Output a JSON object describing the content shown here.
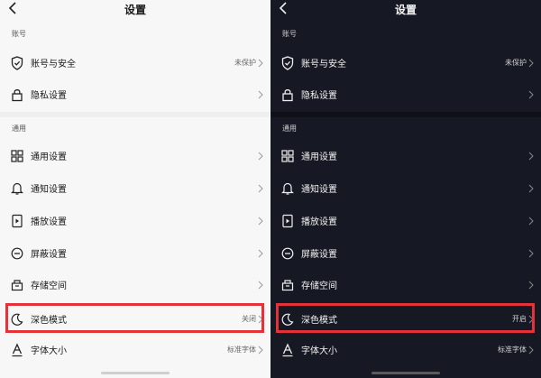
{
  "light": {
    "title": "设置",
    "sections": [
      {
        "label": "账号",
        "items": [
          {
            "icon": "shield-icon",
            "label": "账号与安全",
            "value": "未保护"
          },
          {
            "icon": "lock-icon",
            "label": "隐私设置",
            "value": ""
          }
        ]
      },
      {
        "label": "通用",
        "items": [
          {
            "icon": "grid-icon",
            "label": "通用设置",
            "value": ""
          },
          {
            "icon": "bell-icon",
            "label": "通知设置",
            "value": ""
          },
          {
            "icon": "play-icon",
            "label": "播放设置",
            "value": ""
          },
          {
            "icon": "block-icon",
            "label": "屏蔽设置",
            "value": ""
          },
          {
            "icon": "storage-icon",
            "label": "存储空间",
            "value": ""
          },
          {
            "icon": "moon-icon",
            "label": "深色模式",
            "value": "关闭"
          },
          {
            "icon": "font-icon",
            "label": "字体大小",
            "value": "标准字体"
          }
        ]
      }
    ]
  },
  "dark": {
    "title": "设置",
    "sections": [
      {
        "label": "账号",
        "items": [
          {
            "icon": "shield-icon",
            "label": "账号与安全",
            "value": "未保护"
          },
          {
            "icon": "lock-icon",
            "label": "隐私设置",
            "value": ""
          }
        ]
      },
      {
        "label": "通用",
        "items": [
          {
            "icon": "grid-icon",
            "label": "通用设置",
            "value": ""
          },
          {
            "icon": "bell-icon",
            "label": "通知设置",
            "value": ""
          },
          {
            "icon": "play-icon",
            "label": "播放设置",
            "value": ""
          },
          {
            "icon": "block-icon",
            "label": "屏蔽设置",
            "value": ""
          },
          {
            "icon": "storage-icon",
            "label": "存储空间",
            "value": ""
          },
          {
            "icon": "moon-icon",
            "label": "深色模式",
            "value": "开启"
          },
          {
            "icon": "font-icon",
            "label": "字体大小",
            "value": "标准字体"
          }
        ]
      }
    ]
  },
  "highlight_color": "#e53238"
}
